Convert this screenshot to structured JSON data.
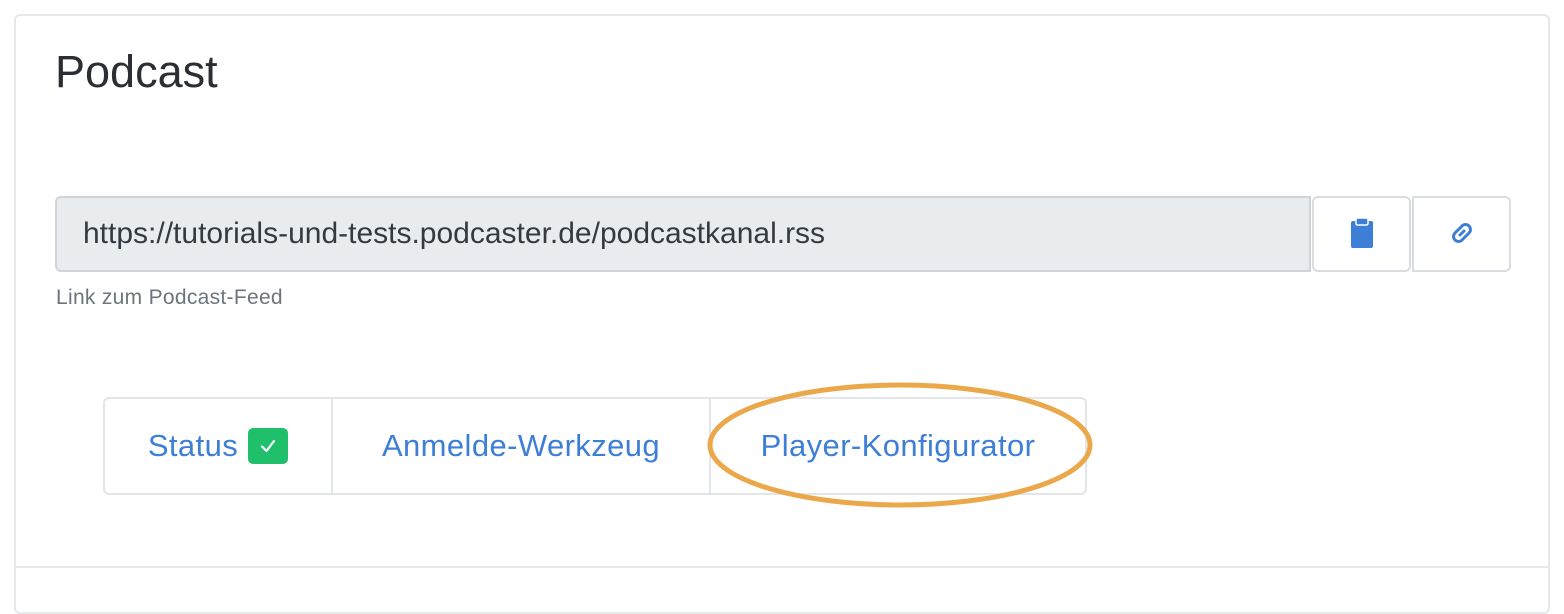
{
  "panel": {
    "title": "Podcast"
  },
  "feed": {
    "url": "https://tutorials-und-tests.podcaster.de/podcastkanal.rss",
    "help_text": "Link zum Podcast-Feed",
    "copy_icon": "clipboard-icon",
    "link_icon": "link-icon"
  },
  "tabs": [
    {
      "label": "Status",
      "badge_icon": "check-icon"
    },
    {
      "label": "Anmelde-Werkzeug"
    },
    {
      "label": "Player-Konfigurator",
      "highlighted": true
    }
  ],
  "colors": {
    "accent_blue": "#3d7fd6",
    "status_green": "#1fbf6b",
    "highlight_orange": "#eba84a",
    "input_background": "#e9ecef"
  }
}
